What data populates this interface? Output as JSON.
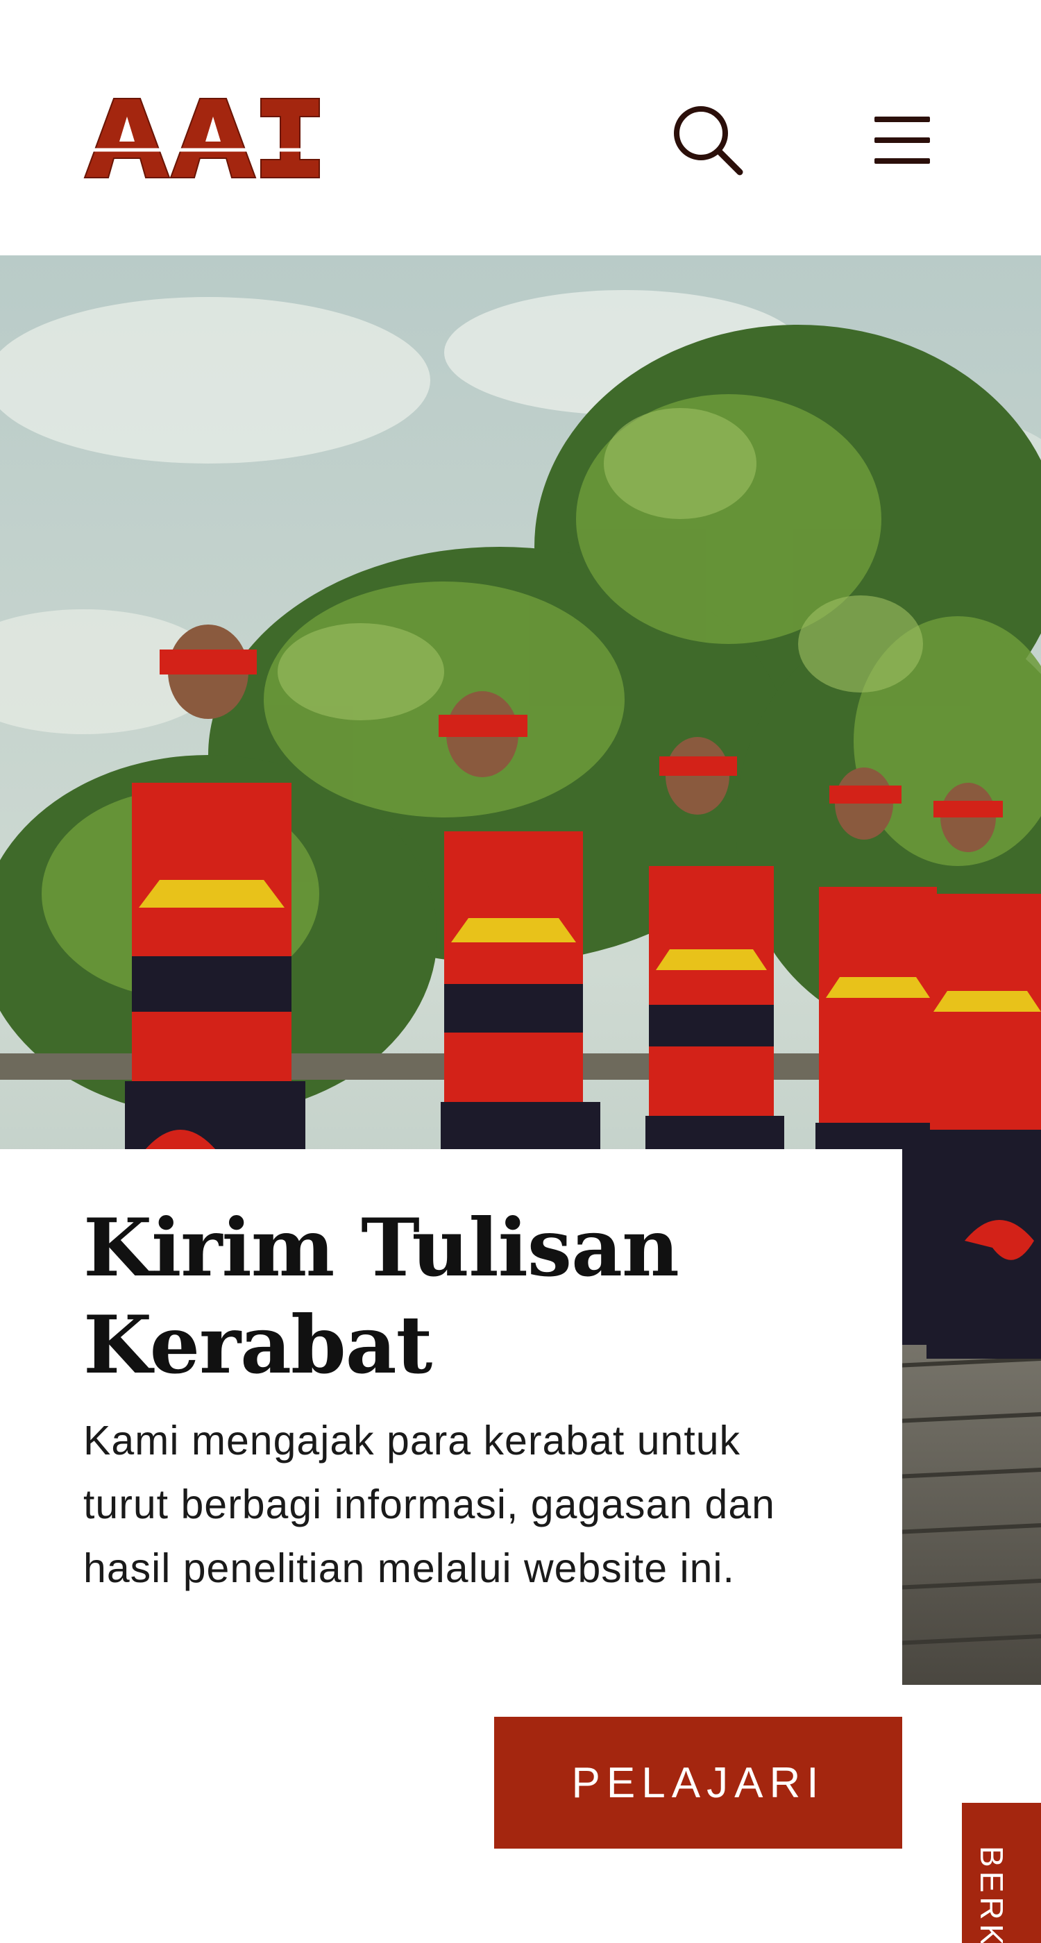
{
  "header": {
    "logo_text": "AAI",
    "logo_icon": "aai-logo",
    "search_icon": "search-icon",
    "menu_icon": "hamburger-menu-icon"
  },
  "hero": {
    "image_subject": "Dayak girls in red traditional costumes dancing in front of green trees"
  },
  "card": {
    "title": "Kirim Tulisan Kerabat",
    "text": "Kami mengajak para kerabat untuk turut berbagi informasi, gagasan dan hasil penelitian melalui website ini."
  },
  "cta": {
    "label": "PELAJARI"
  },
  "side_tab": {
    "label": "BERKA"
  },
  "colors": {
    "accent": "#a4260f",
    "icon": "#2b0f0a",
    "text": "#111111",
    "background": "#ffffff"
  }
}
